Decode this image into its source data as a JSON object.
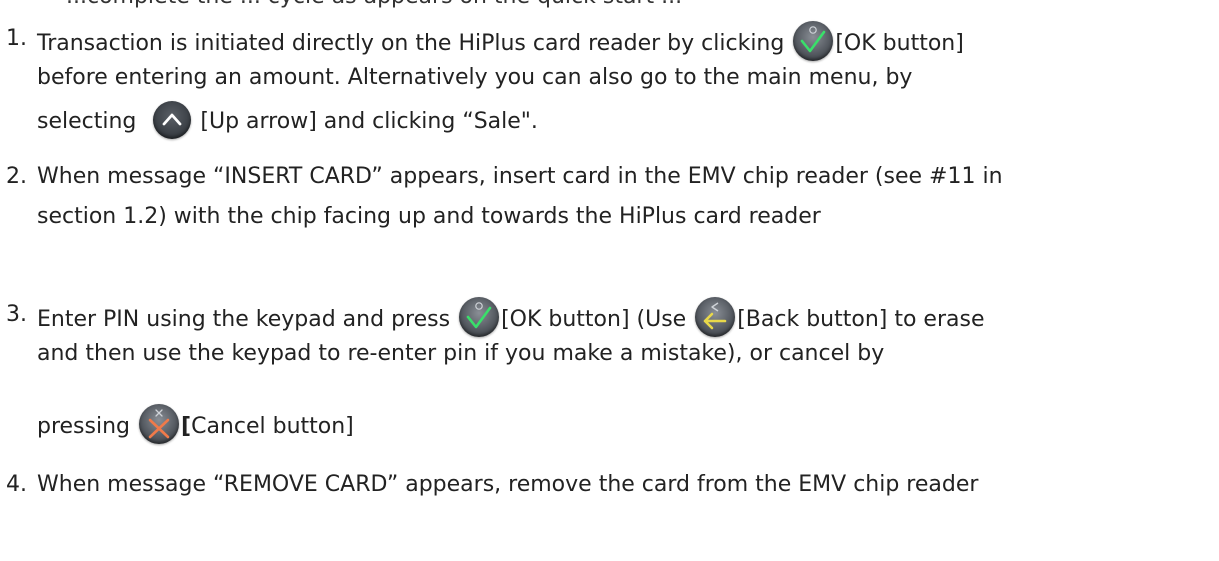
{
  "header_fragment": "...complete the ... cycle as appears on the quick start ...",
  "steps": [
    {
      "num": "1.",
      "l1a": "Transaction is initiated directly on the HiPlus card reader by clicking",
      "l1b": "[OK button]",
      "l2": "before entering an amount. Alternatively you can also go to the main menu, by",
      "l3a": "selecting",
      "l3b": "[Up arrow] and clicking “Sale\".",
      "icons": [
        "ok-button-icon",
        "up-arrow-button-icon"
      ]
    },
    {
      "num": "2.",
      "l1": "When message “INSERT CARD” appears, insert card in the EMV chip reader (see #11 in",
      "l2": "section 1.2)  with the chip facing up and towards the HiPlus card reader"
    },
    {
      "num": "3.",
      "l1a": "Enter PIN using the keypad and press",
      "l1b": "[OK button] (Use",
      "l1c": "[Back button] to erase",
      "l2": "and then use the keypad to re-enter pin if you make a mistake), or cancel by",
      "l3a": "pressing",
      "l3b": "[",
      "l3c": "Cancel button]",
      "icons": [
        "ok-button-icon",
        "back-button-icon",
        "cancel-button-icon"
      ]
    },
    {
      "num": "4.",
      "l1": "When message “REMOVE CARD” appears, remove the card from the EMV chip reader"
    }
  ],
  "colors": {
    "ok_check": "#39e06a",
    "back_arrow": "#e8d84a",
    "cancel_x": "#f07a4a",
    "button_gray": "#54595f"
  }
}
